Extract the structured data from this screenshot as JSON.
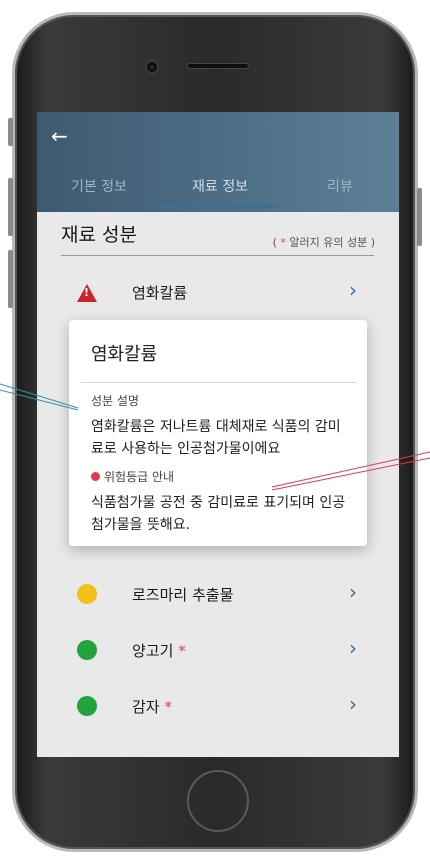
{
  "screen": {
    "tabs": [
      {
        "label": "기본 정보"
      },
      {
        "label": "재료 정보"
      },
      {
        "label": "리뷰"
      }
    ],
    "active_tab_index": 1,
    "section_title": "재료 성분",
    "legend": {
      "paren_open": "(",
      "star": "*",
      "text": "알러지 유의 성분",
      "paren_close": ")"
    },
    "ingredients": [
      {
        "label": "염화칼륨",
        "status": "danger",
        "allergy": false,
        "icon": "warning-triangle-icon"
      },
      {
        "label": "로즈마리 추출물",
        "status": "caution",
        "allergy": false,
        "icon": "yellow-dot-icon"
      },
      {
        "label": "양고기",
        "status": "safe",
        "allergy": true,
        "icon": "green-dot-icon"
      },
      {
        "label": "감자",
        "status": "safe",
        "allergy": true,
        "icon": "green-dot-icon"
      }
    ],
    "allergy_mark": "*",
    "chevron": "›"
  },
  "modal": {
    "title": "염화칼륨",
    "desc_label": "성분 설명",
    "description": "염화칼륨은 저나트륨 대체재로 식품의 감미료로 사용하는 인공첨가물이에요",
    "risk_label": "위험등급 안내",
    "risk_description": "식품첨가물 공전 중 감미료로 표기되며 인공첨가물을 뜻해요."
  },
  "colors": {
    "header": "#4f7089",
    "accent": "#3f6d93",
    "danger": "#c8262f",
    "allergy_star": "#e03a52",
    "safe": "#22a33c",
    "caution": "#f0c21a"
  }
}
